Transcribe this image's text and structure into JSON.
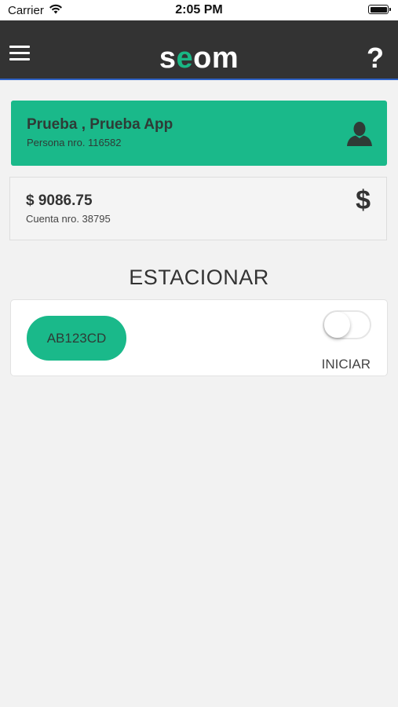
{
  "status_bar": {
    "carrier": "Carrier",
    "time": "2:05 PM",
    "wifi_icon": "wifi-icon",
    "battery_icon": "battery-icon"
  },
  "header": {
    "logo_left": "s",
    "logo_accent": "e",
    "logo_right": "om",
    "menu_icon": "hamburger-icon",
    "help_label": "?"
  },
  "person": {
    "name": "Prueba , Prueba App",
    "number": "Persona nro. 116582",
    "icon": "user-icon"
  },
  "account": {
    "balance": "$ 9086.75",
    "number": "Cuenta nro. 38795",
    "icon_label": "$"
  },
  "parking": {
    "title": "ESTACIONAR",
    "plate": "AB123CD",
    "toggle_on": false,
    "toggle_label": "INICIAR"
  },
  "colors": {
    "accent": "#1ab98a",
    "navbar": "#333333",
    "background": "#f2f2f2"
  }
}
